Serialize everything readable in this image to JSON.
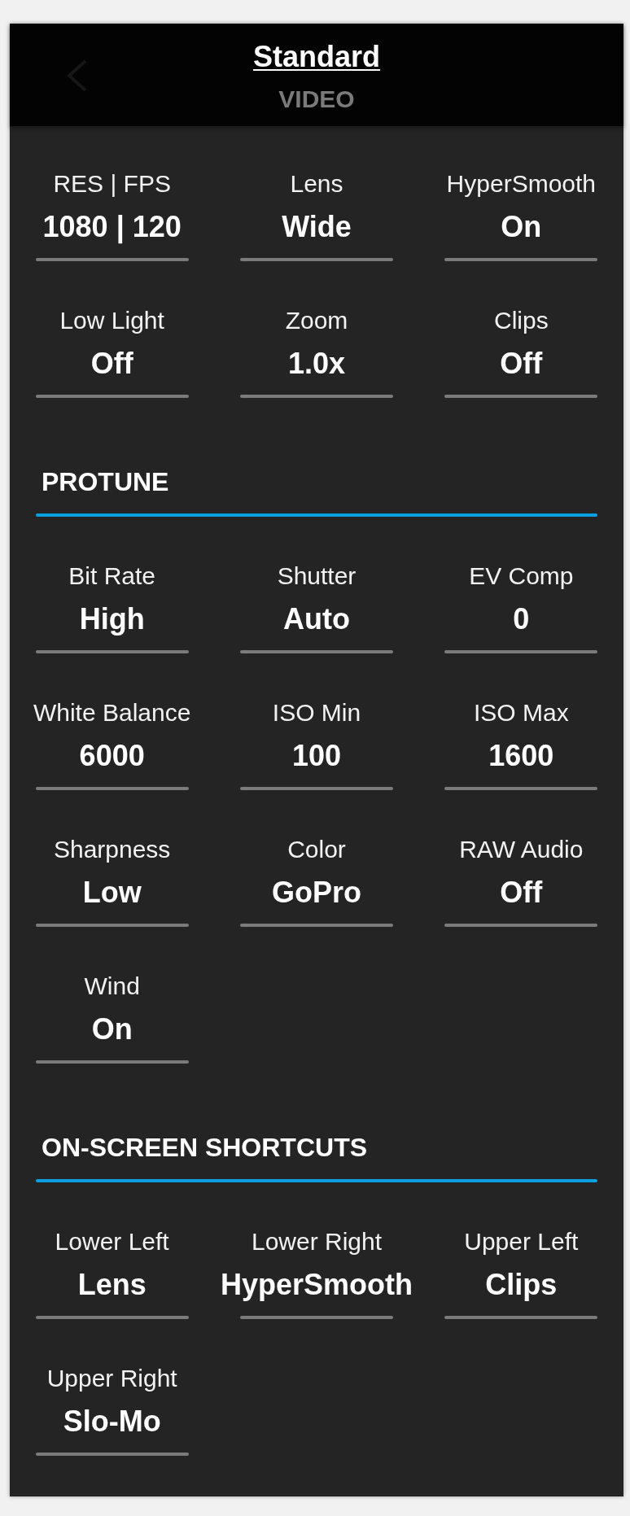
{
  "header": {
    "title": "Standard",
    "subtitle": "VIDEO"
  },
  "sections": [
    {
      "settings": [
        {
          "label": "RES | FPS",
          "value": "1080 | 120"
        },
        {
          "label": "Lens",
          "value": "Wide"
        },
        {
          "label": "HyperSmooth",
          "value": "On"
        },
        {
          "label": "Low Light",
          "value": "Off"
        },
        {
          "label": "Zoom",
          "value": "1.0x"
        },
        {
          "label": "Clips",
          "value": "Off"
        }
      ]
    },
    {
      "heading": "PROTUNE",
      "settings": [
        {
          "label": "Bit Rate",
          "value": "High"
        },
        {
          "label": "Shutter",
          "value": "Auto"
        },
        {
          "label": "EV Comp",
          "value": "0"
        },
        {
          "label": "White Balance",
          "value": "6000"
        },
        {
          "label": "ISO Min",
          "value": "100"
        },
        {
          "label": "ISO Max",
          "value": "1600"
        },
        {
          "label": "Sharpness",
          "value": "Low"
        },
        {
          "label": "Color",
          "value": "GoPro"
        },
        {
          "label": "RAW Audio",
          "value": "Off"
        },
        {
          "label": "Wind",
          "value": "On"
        }
      ]
    },
    {
      "heading": "ON-SCREEN SHORTCUTS",
      "settings": [
        {
          "label": "Lower Left",
          "value": "Lens"
        },
        {
          "label": "Lower Right",
          "value": "HyperSmooth"
        },
        {
          "label": "Upper Left",
          "value": "Clips"
        },
        {
          "label": "Upper Right",
          "value": "Slo-Mo"
        }
      ]
    }
  ]
}
